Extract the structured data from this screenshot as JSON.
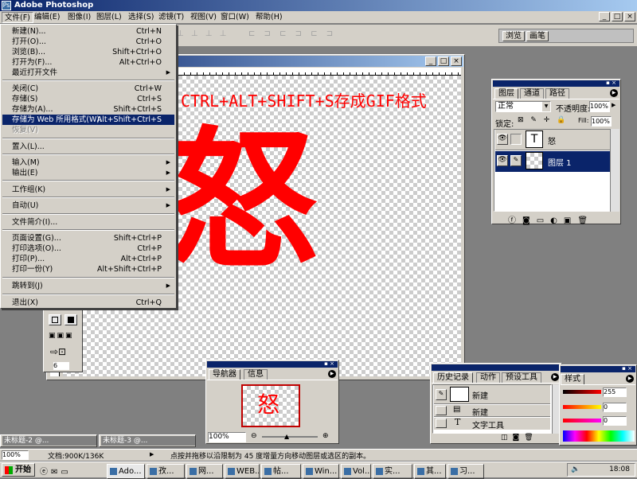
{
  "app": {
    "title": "Adobe Photoshop",
    "win_min": "_",
    "win_max": "□",
    "win_close": "×"
  },
  "menubar": {
    "items": [
      "文件(F)",
      "编辑(E)",
      "图像(I)",
      "图层(L)",
      "选择(S)",
      "滤镜(T)",
      "视图(V)",
      "窗口(W)",
      "帮助(H)"
    ]
  },
  "options_bar": {
    "palette_tabs": [
      "浏览",
      "画笔"
    ]
  },
  "file_menu": {
    "items": [
      {
        "label": "新建(N)...",
        "shortcut": "Ctrl+N"
      },
      {
        "label": "打开(O)...",
        "shortcut": "Ctrl+O"
      },
      {
        "label": "浏览(B)...",
        "shortcut": "Shift+Ctrl+O"
      },
      {
        "label": "打开为(F)...",
        "shortcut": "Alt+Ctrl+O"
      },
      {
        "label": "最近打开文件",
        "submenu": "▶"
      },
      {
        "label": "关闭(C)",
        "shortcut": "Ctrl+W"
      },
      {
        "label": "存储(S)",
        "shortcut": "Ctrl+S"
      },
      {
        "label": "存储为(A)...",
        "shortcut": "Shift+Ctrl+S"
      },
      {
        "label": "存储为 Web 所用格式(W)...",
        "shortcut": "Alt+Shift+Ctrl+S"
      },
      {
        "label": "恢复(V)"
      },
      {
        "label": "置入(L)..."
      },
      {
        "label": "输入(M)",
        "submenu": "▶"
      },
      {
        "label": "输出(E)",
        "submenu": "▶"
      },
      {
        "label": "工作组(K)",
        "submenu": "▶"
      },
      {
        "label": "自动(U)",
        "submenu": "▶"
      },
      {
        "label": "文件简介(I)..."
      },
      {
        "label": "页面设置(G)...",
        "shortcut": "Shift+Ctrl+P"
      },
      {
        "label": "打印选项(O)...",
        "shortcut": "Ctrl+P"
      },
      {
        "label": "打印(P)...",
        "shortcut": "Alt+Ctrl+P"
      },
      {
        "label": "打印一份(Y)",
        "shortcut": "Alt+Shift+Ctrl+P"
      },
      {
        "label": "跳转到(J)",
        "submenu": "▶"
      },
      {
        "label": "退出(X)",
        "shortcut": "Ctrl+Q"
      }
    ]
  },
  "document": {
    "annotation": "CTRL+ALT+SHIFT+S存成GIF格式",
    "glyph": "怒",
    "annotation_color": "#ff0000",
    "glyph_color": "#ff0000"
  },
  "layers_panel": {
    "tabs": [
      "图层",
      "通道",
      "路径"
    ],
    "blend_mode": "正常",
    "opacity_label": "不透明度:",
    "opacity_value": "100%",
    "lock_label": "锁定:",
    "fill_label": "Fill:",
    "fill_value": "100%",
    "layers": [
      {
        "name": "怒",
        "thumb": "T"
      },
      {
        "name": "图层 1"
      }
    ]
  },
  "navigator_panel": {
    "tabs": [
      "导航器",
      "信息"
    ],
    "zoom": "100%",
    "preview_glyph": "怒"
  },
  "history_panel": {
    "tabs": [
      "历史记录",
      "动作",
      "预设工具"
    ],
    "snapshot": "新建",
    "items": [
      {
        "label": "新建"
      },
      {
        "label": "文字工具"
      }
    ]
  },
  "color_panel": {
    "tab": "样式",
    "r": "255",
    "g": "0",
    "b": "0"
  },
  "minimized_docs": [
    {
      "title": "未标题-2 @..."
    },
    {
      "title": "未标题-3 @..."
    }
  ],
  "status_bar": {
    "zoom": "100%",
    "doc_size": "文档:900K/136K",
    "hint": "点按并拖移以沿限制为 45 度增量方向移动图层或选区的副本。"
  },
  "taskbar": {
    "start": "开始",
    "buttons": [
      "Ado...",
      "孜...",
      "网...",
      "WEB...",
      "帖...",
      "Win...",
      "Vol...",
      "实...",
      "其...",
      "习..."
    ],
    "clock": "18:08"
  }
}
